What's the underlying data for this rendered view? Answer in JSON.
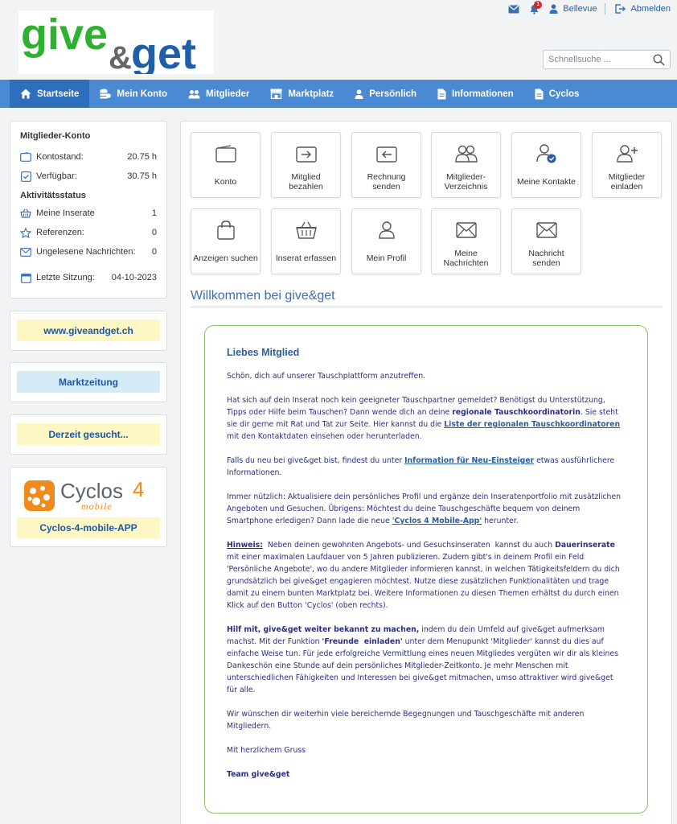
{
  "header": {
    "logo_text_1": "give",
    "logo_text_2": "&",
    "logo_text_3": "get",
    "user_name": "Bellevue",
    "logout_label": "Abmelden",
    "notification_count": "1",
    "search_placeholder": "Schnellsuche ..."
  },
  "nav": {
    "items": [
      {
        "label": "Startseite",
        "icon": "home-icon"
      },
      {
        "label": "Mein Konto",
        "icon": "coins-icon"
      },
      {
        "label": "Mitglieder",
        "icon": "users-icon"
      },
      {
        "label": "Marktplatz",
        "icon": "store-icon"
      },
      {
        "label": "Persönlich",
        "icon": "person-icon"
      },
      {
        "label": "Informationen",
        "icon": "document-icon"
      },
      {
        "label": "Cyclos",
        "icon": "document-icon"
      }
    ]
  },
  "sidebar": {
    "account_title": "Mitglieder-Konto",
    "balance_label": "Kontostand:",
    "balance_value": "20.75 h",
    "available_label": "Verfügbar:",
    "available_value": "30.75 h",
    "activity_title": "Aktivitätsstatus",
    "ads_label": "Meine Inserate",
    "ads_value": "1",
    "refs_label": "Referenzen:",
    "refs_value": "0",
    "unread_label": "Ungelesene Nachrichten:",
    "unread_value": "0",
    "last_session_label": "Letzte Sitzung:",
    "last_session_value": "04-10-2023",
    "banner_website": "www.giveandget.ch",
    "banner_marktzeitung": "Marktzeitung",
    "banner_gesucht": "Derzeit gesucht...",
    "cyclos_logo_text": "Cyclos",
    "cyclos_logo_num": "4",
    "cyclos_logo_sub": "mobile",
    "cyclos_app": "Cyclos-4-mobile-APP"
  },
  "tiles": [
    {
      "label": "Konto",
      "icon": "wallet-icon"
    },
    {
      "label": "Mitglied bezahlen",
      "icon": "pay-icon"
    },
    {
      "label": "Rechnung senden",
      "icon": "invoice-icon"
    },
    {
      "label": "Mitglieder-Verzeichnis",
      "icon": "users-icon"
    },
    {
      "label": "Meine Kontakte",
      "icon": "contact-check-icon"
    },
    {
      "label": "Mitglieder einladen",
      "icon": "user-plus-icon"
    },
    {
      "label": "Anzeigen suchen",
      "icon": "shopping-bag-icon"
    },
    {
      "label": "Inserat erfassen",
      "icon": "basket-icon"
    },
    {
      "label": "Mein Profil",
      "icon": "person-icon"
    },
    {
      "label": "Meine Nachrichten",
      "icon": "envelope-icon"
    },
    {
      "label": "Nachricht senden",
      "icon": "envelope-icon"
    }
  ],
  "main": {
    "welcome_title": "Willkommen bei give&get",
    "greeting": "Liebes Mitglied",
    "p1": "Schön, dich auf unserer Tauschplattform anzutreffen.",
    "p2_a": "Hat sich auf dein Inserat noch kein geeigneter Tauschpartner gemeldet? Benötigst du Unterstützung, Tipps oder Hilfe beim Tauschen? Dann wende dich an deine ",
    "p2_b": "regionale Tauschkoordinatorin",
    "p2_c": ". Sie steht sie dir gerne mit Rat und Tat zur Seite. Hier kannst du die ",
    "p2_link": "Liste der regionalen Tauschkoordinatoren",
    "p2_d": " mit den Kontaktdaten einsehen oder herunterladen.",
    "p3_a": "Falls du neu bei give&get bist, findest du unter ",
    "p3_link": "Information für Neu-Einsteiger",
    "p3_b": " etwas ausführlichere Informationen.",
    "p4_a": "Immer nützlich: Aktualisiere dein persönliches Profil und ergänze dein Inseratenportfolio mit zusätzlichen Angeboten und Gesuchen. Übrigens: Möchtest du deine Tauschgeschäfte bequem von deinem Smartphone erledigen? Dann lade die neue ",
    "p4_link": "'Cyclos 4 Mobile-App'",
    "p4_b": " herunter.",
    "p5_a": "Hinweis:",
    "p5_b": "  Neben deinen gewohnten Angebots- und Gesuchsinseraten  kannst du auch ",
    "p5_c": "Dauerinserate",
    "p5_d": " mit einer maximalen Laufdauer von 5 Jahren publizieren. Zudem gibt's in deinem Profil ein Feld 'Persönliche Angebote', wo du andere Mitglieder informieren kannst, in welchen Tätigkeitsfeldern du dich grundsätzlich bei give&get engagieren möchtest. Nutze diese zusätzlichen Funktionalitäten und trage damit zu einem bunten Marktplatz bei. Weitere Informationen zu diesen Themen erhältst du durch einen Klick auf den Button 'Cyclos' (oben rechts).",
    "p6_a": "Hilf mit, give&get weiter bekannt zu machen,",
    "p6_b": " indem du dein Umfeld auf give&get aufmerksam machst. Mit der Funktion ",
    "p6_c": "'Freunde  einladen'",
    "p6_d": " unter dem Menupunkt 'Mitglieder' kannst du dies auf einfache Weise tun. Für jede erfolgreiche Vermittlung eines neuen Mitgliedes vergüten wir dir als kleines Dankeschön eine Stunde auf dein persönliches Mitglieder-Zeitkonto. Je mehr Menschen mit unterschiedlichen Fähigkeiten und Interessen bei give&get mitmachen, umso attraktiver wird give&get für alle.",
    "p7": "Wir wünschen dir weiterhin viele bereichernde Begegnungen und Tauschgeschäfte mit anderen Mitgliedern.",
    "p8": "Mit herzlichem Gruss",
    "p9": "Team give&get"
  },
  "colors": {
    "nav": "#4a8ad2",
    "nav_active": "#2d6fba",
    "logo_green": "#2fb02f",
    "logo_blue": "#1f5fa8",
    "banner_yellow": "#fdf7c3",
    "banner_blue": "#d3ecf7",
    "message_border": "#8dc36a"
  }
}
